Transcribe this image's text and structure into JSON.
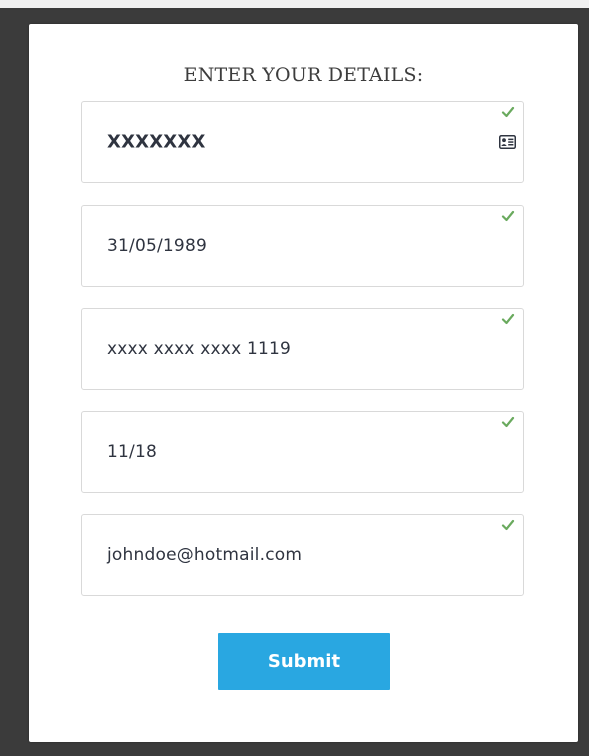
{
  "form": {
    "title": "ENTER YOUR DETAILS:",
    "fields": [
      {
        "value": "XXXXXXX",
        "valid": true,
        "icon": "id-card-icon"
      },
      {
        "value": "31/05/1989",
        "valid": true
      },
      {
        "value": "xxxx xxxx xxxx 1119",
        "valid": true
      },
      {
        "value": "11/18",
        "valid": true
      },
      {
        "value": "johndoe@hotmail.com",
        "valid": true
      }
    ],
    "submit_label": "Submit"
  },
  "colors": {
    "accent": "#29a7e1",
    "check": "#6aaa5e",
    "border": "#d9d9d9",
    "backdrop": "#3b3b3b"
  }
}
